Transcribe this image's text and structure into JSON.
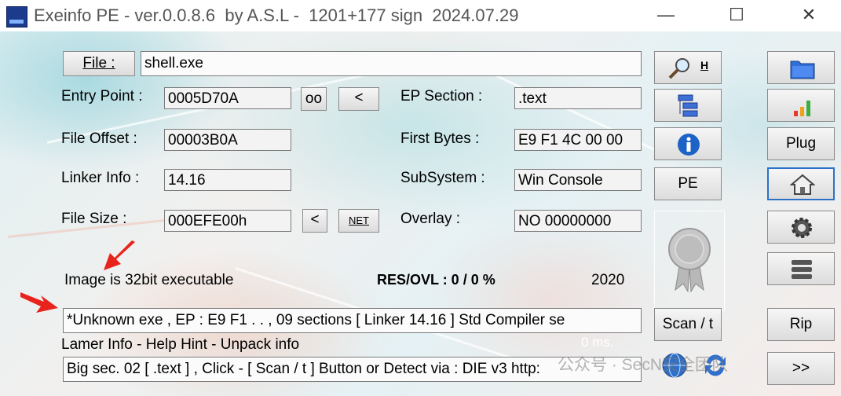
{
  "window": {
    "title": "Exeinfo PE - ver.0.0.8.6  by A.S.L -  1201+177 sign  2024.07.29",
    "minimize": "—",
    "maximize": "☐",
    "close": "✕"
  },
  "file": {
    "button_label": "File :",
    "path": "shell.exe"
  },
  "fields": {
    "entry_point_label": "Entry Point :",
    "entry_point": "0005D70A",
    "oo_button": "oo",
    "lt_button": "<",
    "file_offset_label": "File Offset :",
    "file_offset": "00003B0A",
    "linker_info_label": "Linker Info :",
    "linker_info": "14.16",
    "file_size_label": "File Size :",
    "file_size": "000EFE00h",
    "size_lt_button": "<",
    "net_button": "NET",
    "ep_section_label": "EP Section :",
    "ep_section": ".text",
    "first_bytes_label": "First Bytes :",
    "first_bytes": "E9 F1 4C 00 00",
    "subsystem_label": "SubSystem :",
    "subsystem": "Win Console",
    "overlay_label": "Overlay :",
    "overlay": "NO   00000000"
  },
  "status": {
    "image_bits": "Image is 32bit executable",
    "res_ovl": "RES/OVL : 0 / 0 %",
    "year": "2020",
    "detection": "*Unknown exe , EP : E9 F1 . . , 09 sections  [ Linker 14.16 ]  Std Compiler se",
    "lamer_info": "Lamer Info - Help Hint - Unpack info",
    "timing": "0 ms.",
    "hint": "Big sec. 02 [ .text ] , Click - [ Scan / t ]  Button  or Detect via : DIE v3  http:"
  },
  "toolbar": {
    "search_hotkey": "H",
    "pe_button": "PE",
    "scan_button": "Scan / t"
  },
  "sidebar": {
    "plug_button": "Plug",
    "rip_button": "Rip",
    "forward_button": ">>"
  },
  "watermark": "公众号 · SecN安全团队",
  "colors": {
    "accent_blue": "#2a72c8",
    "arrow_red": "#e8231b",
    "info_blue": "#1d63c6"
  },
  "icons": [
    "folder-icon",
    "bars-chart-icon",
    "search-icon",
    "tree-list-icon",
    "info-icon",
    "badge-icon",
    "home-icon",
    "gear-icon",
    "stack-icon",
    "globe-icon",
    "refresh-icon"
  ]
}
